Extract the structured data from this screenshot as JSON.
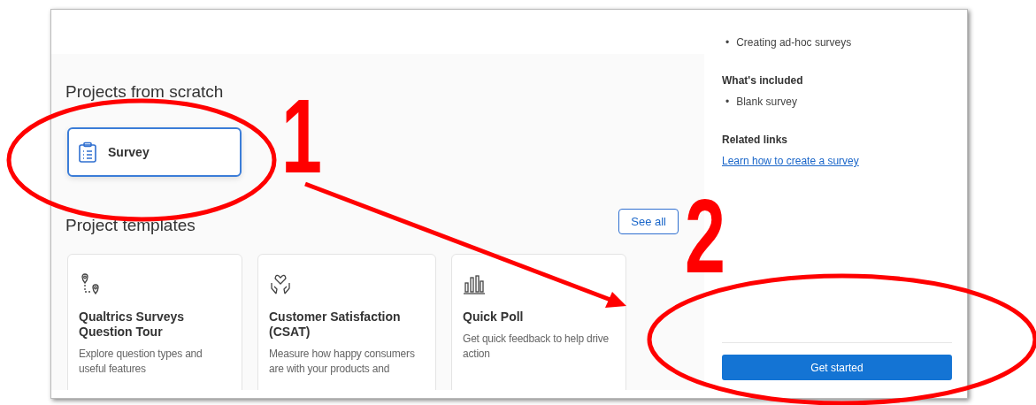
{
  "scratch": {
    "heading": "Projects from scratch",
    "items": [
      {
        "label": "Survey",
        "selected": true
      }
    ]
  },
  "templates": {
    "heading": "Project templates",
    "see_all": "See all",
    "cards": [
      {
        "kind": "route",
        "title": "Qualtrics Surveys Question Tour",
        "description": "Explore question types and useful features"
      },
      {
        "kind": "care",
        "title": "Customer Satisfaction (CSAT)",
        "description": "Measure how happy consumers are with your products and"
      },
      {
        "kind": "poll",
        "title": "Quick Poll",
        "description": "Get quick feedback to help drive action"
      }
    ]
  },
  "details": {
    "use_cases": [
      {
        "marker": "•",
        "text": "Creating ad-hoc surveys"
      }
    ],
    "included_heading": "What's included",
    "included": [
      {
        "marker": "•",
        "text": "Blank survey"
      }
    ],
    "links_heading": "Related links",
    "links": [
      "Learn how to create a survey"
    ],
    "action": "Get started"
  },
  "annotations": {
    "callouts": [
      "1",
      "2"
    ]
  }
}
